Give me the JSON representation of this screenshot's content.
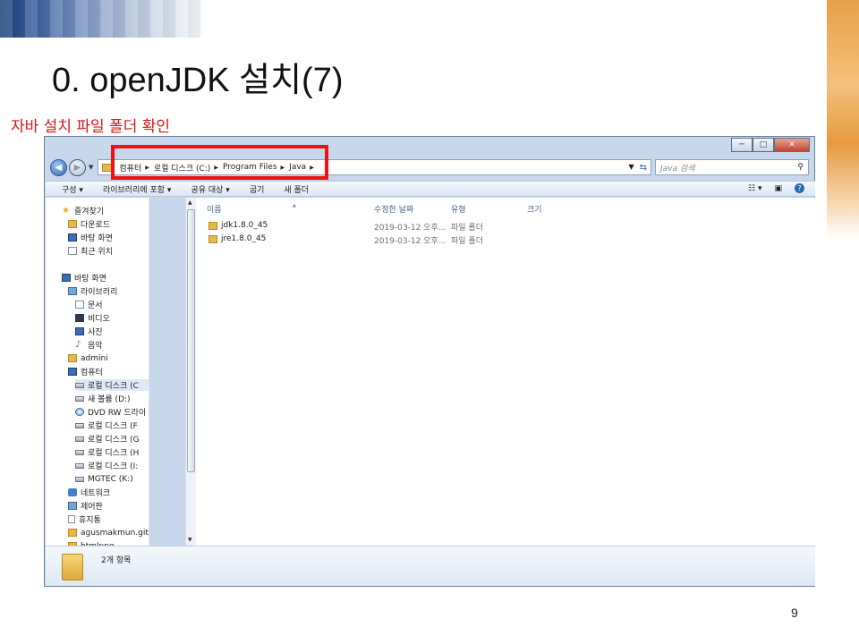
{
  "slide": {
    "title": "0. openJDK 설치(7)",
    "subtitle": "자바 설치 파일 폴더 확인",
    "page_number": "9"
  },
  "window": {
    "caption_buttons": {
      "minimize": "─",
      "maximize": "□",
      "close": "✕"
    },
    "address": {
      "crumbs": [
        "컴퓨터",
        "로컬 디스크 (C:)",
        "Program Files",
        "Java"
      ],
      "separator": "▶"
    },
    "search": {
      "placeholder": "Java 검색"
    },
    "toolbar": {
      "items": [
        "구성 ▾",
        "라이브러리에 포함 ▾",
        "공유 대상 ▾",
        "굽기",
        "새 폴더"
      ]
    },
    "nav_pane": {
      "items": [
        {
          "label": "즐겨찾기",
          "icon": "star-icon"
        },
        {
          "label": "다운로드",
          "icon": "download-folder-icon"
        },
        {
          "label": "바탕 화면",
          "icon": "desktop-icon"
        },
        {
          "label": "최근 위치",
          "icon": "recent-places-icon"
        },
        {
          "label": "바탕 화면",
          "icon": "desktop-icon"
        },
        {
          "label": "라이브러리",
          "icon": "library-icon"
        },
        {
          "label": "문서",
          "icon": "documents-icon"
        },
        {
          "label": "비디오",
          "icon": "video-icon"
        },
        {
          "label": "사진",
          "icon": "pictures-icon"
        },
        {
          "label": "음악",
          "icon": "music-icon"
        },
        {
          "label": "admini",
          "icon": "user-folder-icon"
        },
        {
          "label": "컴퓨터",
          "icon": "computer-icon"
        },
        {
          "label": "로컬 디스크 (C",
          "icon": "drive-icon"
        },
        {
          "label": "새 볼륨 (D:)",
          "icon": "drive-icon"
        },
        {
          "label": "DVD RW 드라이",
          "icon": "dvd-icon"
        },
        {
          "label": "로컬 디스크 (F",
          "icon": "drive-icon"
        },
        {
          "label": "로컬 디스크 (G",
          "icon": "drive-icon"
        },
        {
          "label": "로컬 디스크 (H",
          "icon": "drive-icon"
        },
        {
          "label": "로컬 디스크 (I:",
          "icon": "drive-icon"
        },
        {
          "label": "MGTEC (K:)",
          "icon": "drive-icon"
        },
        {
          "label": "네트워크",
          "icon": "network-icon"
        },
        {
          "label": "제어판",
          "icon": "control-panel-icon"
        },
        {
          "label": "휴지통",
          "icon": "recycle-bin-icon"
        },
        {
          "label": "agusmakmun.git",
          "icon": "folder-icon"
        },
        {
          "label": "htmlpng",
          "icon": "folder-icon"
        }
      ]
    },
    "columns": [
      "이름",
      "수정한 날짜",
      "유형",
      "크기"
    ],
    "files": [
      {
        "name": "jdk1.8.0_45",
        "modified": "2019-03-12 오후...",
        "type": "파일 폴더",
        "size": ""
      },
      {
        "name": "jre1.8.0_45",
        "modified": "2019-03-12 오후...",
        "type": "파일 폴더",
        "size": ""
      }
    ],
    "details": {
      "item_count": "2개 항목"
    }
  }
}
